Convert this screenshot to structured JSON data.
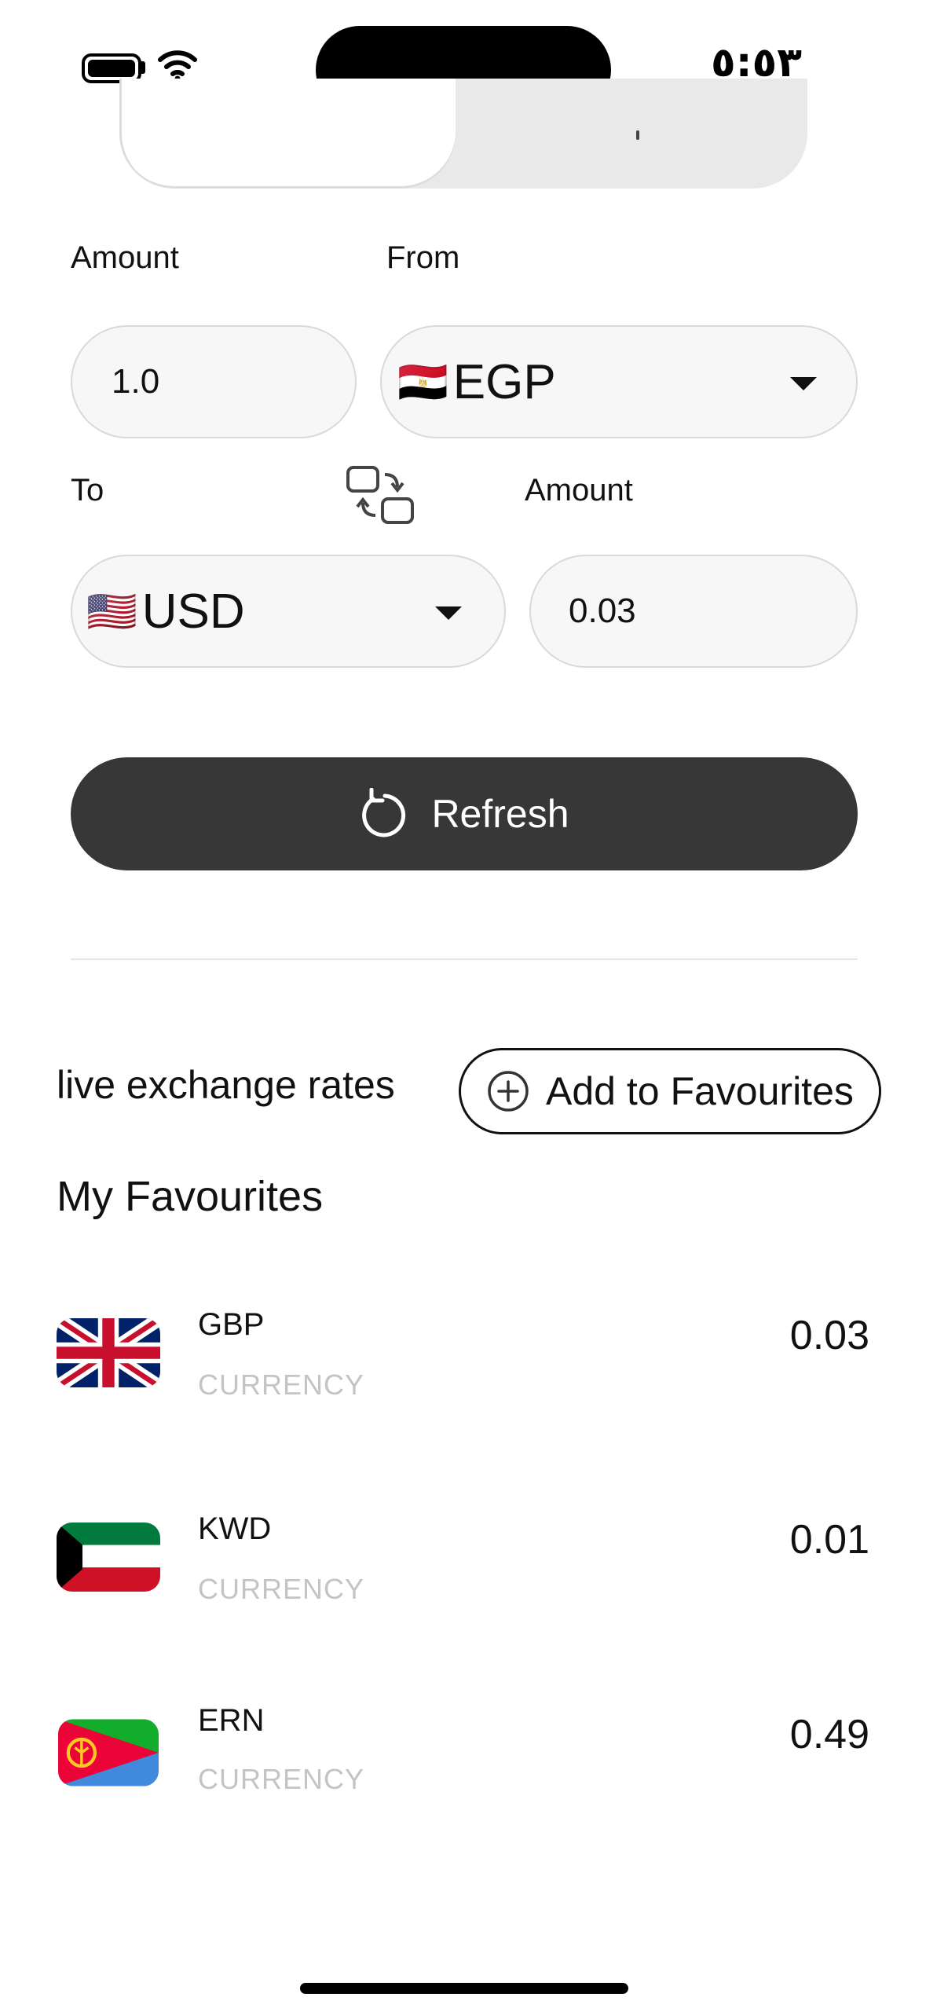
{
  "status_bar": {
    "time": "٥:٥٣"
  },
  "converter": {
    "amount_label": "Amount",
    "from_label": "From",
    "amount_value": "1.0",
    "from_currency": {
      "code": "EGP",
      "flag": "🇪🇬"
    },
    "to_label": "To",
    "result_label": "Amount",
    "to_currency": {
      "code": "USD",
      "flag": "🇺🇸"
    },
    "result_value": "0.03",
    "refresh_label": "Refresh"
  },
  "live_rates": {
    "title": "live exchange rates",
    "add_favourites_label": "Add to Favourites"
  },
  "favourites": {
    "title": "My Favourites",
    "items": [
      {
        "code": "GBP",
        "subtitle": "CURRENCY",
        "value": "0.03",
        "flag": "gb"
      },
      {
        "code": "KWD",
        "subtitle": "CURRENCY",
        "value": "0.01",
        "flag": "kw"
      },
      {
        "code": "ERN",
        "subtitle": "CURRENCY",
        "value": "0.49",
        "flag": "er"
      }
    ]
  },
  "colors": {
    "primary_button": "#373737",
    "field_bg": "#f7f7f7",
    "muted_text": "#c4c4c4"
  }
}
